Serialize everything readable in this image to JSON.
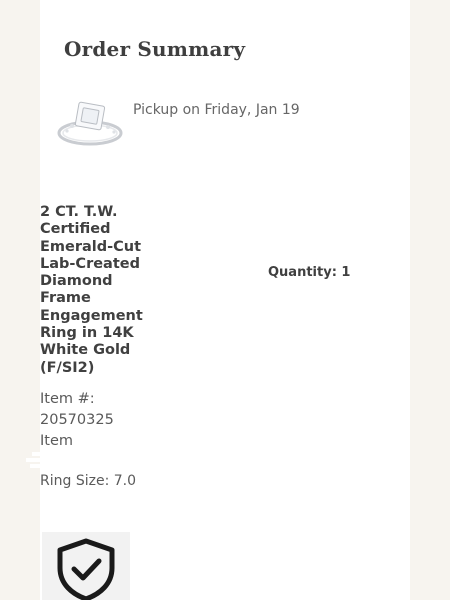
{
  "order_summary": {
    "title": "Order Summary",
    "pickup_text": "Pickup on Friday, Jan 19",
    "product": {
      "thumbnail_icon": "ring-thumbnail",
      "name": "2 CT. T.W. Certified Emerald-Cut Lab-Created Diamond Frame Engagement Ring in 14K White Gold (F/SI2)",
      "quantity_text": "Quantity: 1",
      "item_number_text": "Item #: 20570325 Item",
      "ring_size_text": "Ring Size: 7.0"
    },
    "badge_icon": "shield-check-icon"
  }
}
